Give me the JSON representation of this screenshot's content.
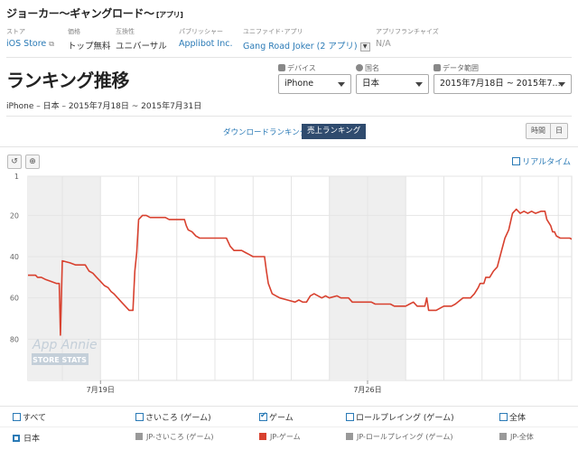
{
  "app": {
    "title": "ジョーカー〜ギャングロード〜",
    "kind": "[アプリ]"
  },
  "meta": [
    {
      "label": "ストア",
      "value": "iOS Store",
      "style": "link",
      "icon": "external-link-icon"
    },
    {
      "label": "価格",
      "value": "トップ無料",
      "style": "plain"
    },
    {
      "label": "互換性",
      "value": "ユニバーサル",
      "style": "plain"
    },
    {
      "label": "パブリッシャー",
      "value": "Applibot Inc.",
      "style": "link"
    },
    {
      "label": "ユニファイド･アプリ",
      "value": "Gang Road Joker (2 アプリ)",
      "style": "link"
    },
    {
      "label": "アプリフランチャイズ",
      "value": "N/A",
      "style": "muted"
    }
  ],
  "page": {
    "title": "ランキング推移",
    "subtitle": "iPhone – 日本 – 2015年7月18日 ~ 2015年7月31日"
  },
  "filters": {
    "device": {
      "label": "デバイス",
      "value": "iPhone"
    },
    "country": {
      "label": "国名",
      "value": "日本"
    },
    "date_range": {
      "label": "データ範囲",
      "value": "2015年7月18日 ~ 2015年7..."
    }
  },
  "tabs": {
    "download": "ダウンロードランキング",
    "revenue": "売上ランキング"
  },
  "period": {
    "hourly": "時間",
    "daily": "日"
  },
  "toolbar": {
    "realtime": "リアルタイム"
  },
  "watermark": {
    "line1": "App Annie",
    "line2": "STORE STATS"
  },
  "chart_data": {
    "type": "line",
    "y_reversed": true,
    "ylim": [
      1,
      100
    ],
    "yticks": [
      1,
      20,
      40,
      60,
      80
    ],
    "xlim": [
      17.1,
      31.35
    ],
    "xticks": [
      {
        "x": 19,
        "label": "7月19日"
      },
      {
        "x": 26,
        "label": "7月26日"
      }
    ],
    "weekend_bands": [
      [
        17.1,
        19
      ],
      [
        25,
        27
      ]
    ],
    "series": [
      {
        "name": "JP-ゲーム",
        "color": "#d8412f",
        "points": [
          [
            17.1,
            49
          ],
          [
            17.3,
            49
          ],
          [
            17.35,
            50
          ],
          [
            17.45,
            50
          ],
          [
            17.55,
            51
          ],
          [
            17.7,
            52
          ],
          [
            17.85,
            53
          ],
          [
            17.92,
            53
          ],
          [
            17.95,
            78
          ],
          [
            18.0,
            42
          ],
          [
            18.2,
            43
          ],
          [
            18.35,
            44
          ],
          [
            18.6,
            44
          ],
          [
            18.7,
            47
          ],
          [
            18.8,
            48
          ],
          [
            18.9,
            50
          ],
          [
            19.0,
            52
          ],
          [
            19.1,
            54
          ],
          [
            19.2,
            55
          ],
          [
            19.28,
            57
          ],
          [
            19.35,
            58
          ],
          [
            19.45,
            60
          ],
          [
            19.55,
            62
          ],
          [
            19.65,
            64
          ],
          [
            19.75,
            66
          ],
          [
            19.85,
            66
          ],
          [
            19.9,
            47
          ],
          [
            19.95,
            38
          ],
          [
            20.0,
            22
          ],
          [
            20.1,
            20
          ],
          [
            20.2,
            20
          ],
          [
            20.3,
            21
          ],
          [
            20.7,
            21
          ],
          [
            20.8,
            22
          ],
          [
            21.2,
            22
          ],
          [
            21.25,
            25
          ],
          [
            21.3,
            27
          ],
          [
            21.4,
            28
          ],
          [
            21.5,
            30
          ],
          [
            21.6,
            31
          ],
          [
            22.3,
            31
          ],
          [
            22.4,
            35
          ],
          [
            22.5,
            37
          ],
          [
            22.7,
            37
          ],
          [
            22.8,
            38
          ],
          [
            22.9,
            39
          ],
          [
            23.0,
            40
          ],
          [
            23.3,
            40
          ],
          [
            23.35,
            47
          ],
          [
            23.4,
            53
          ],
          [
            23.5,
            58
          ],
          [
            23.6,
            59
          ],
          [
            23.7,
            60
          ],
          [
            23.9,
            61
          ],
          [
            24.1,
            62
          ],
          [
            24.2,
            61
          ],
          [
            24.3,
            62
          ],
          [
            24.4,
            62
          ],
          [
            24.5,
            59
          ],
          [
            24.6,
            58
          ],
          [
            24.8,
            60
          ],
          [
            24.9,
            59
          ],
          [
            25.0,
            60
          ],
          [
            25.2,
            59
          ],
          [
            25.3,
            60
          ],
          [
            25.5,
            60
          ],
          [
            25.6,
            62
          ],
          [
            26.1,
            62
          ],
          [
            26.2,
            63
          ],
          [
            26.6,
            63
          ],
          [
            26.7,
            64
          ],
          [
            27.0,
            64
          ],
          [
            27.1,
            63
          ],
          [
            27.2,
            62
          ],
          [
            27.3,
            64
          ],
          [
            27.5,
            64
          ],
          [
            27.55,
            60
          ],
          [
            27.6,
            66
          ],
          [
            27.8,
            66
          ],
          [
            27.9,
            65
          ],
          [
            28.0,
            64
          ],
          [
            28.2,
            64
          ],
          [
            28.3,
            63
          ],
          [
            28.5,
            60
          ],
          [
            28.7,
            60
          ],
          [
            28.8,
            58
          ],
          [
            28.9,
            55
          ],
          [
            28.95,
            53
          ],
          [
            29.05,
            53
          ],
          [
            29.1,
            50
          ],
          [
            29.2,
            50
          ],
          [
            29.3,
            47
          ],
          [
            29.4,
            45
          ],
          [
            29.5,
            38
          ],
          [
            29.6,
            31
          ],
          [
            29.7,
            27
          ],
          [
            29.75,
            23
          ],
          [
            29.8,
            19
          ],
          [
            29.9,
            17
          ],
          [
            30.0,
            19
          ],
          [
            30.1,
            18
          ],
          [
            30.2,
            19
          ],
          [
            30.3,
            18
          ],
          [
            30.4,
            19
          ],
          [
            30.55,
            18
          ],
          [
            30.65,
            18
          ],
          [
            30.7,
            22
          ],
          [
            30.8,
            25
          ],
          [
            30.85,
            28
          ],
          [
            30.9,
            28
          ],
          [
            30.95,
            30
          ],
          [
            31.05,
            31
          ],
          [
            31.3,
            31
          ],
          [
            31.4,
            32
          ],
          [
            31.45,
            28
          ],
          [
            31.5,
            26
          ],
          [
            31.6,
            18
          ],
          [
            32.1,
            18
          ]
        ]
      }
    ]
  },
  "legend": {
    "row1": [
      {
        "label": "すべて",
        "checked": false
      },
      {
        "label": "さいころ (ゲーム)",
        "checked": false
      },
      {
        "label": "ゲーム",
        "checked": true
      },
      {
        "label": "ロールプレイング (ゲーム)",
        "checked": false
      },
      {
        "label": "全体",
        "checked": false
      }
    ],
    "row2": [
      {
        "label": "日本",
        "color": "#2a7ab6",
        "kind": "country"
      },
      {
        "label": "JP-さいころ (ゲーム)",
        "color": "#999999",
        "kind": "series"
      },
      {
        "label": "JP-ゲーム",
        "color": "#d8412f",
        "kind": "series"
      },
      {
        "label": "JP-ロールプレイング (ゲーム)",
        "color": "#999999",
        "kind": "series"
      },
      {
        "label": "JP-全体",
        "color": "#999999",
        "kind": "series"
      }
    ]
  }
}
